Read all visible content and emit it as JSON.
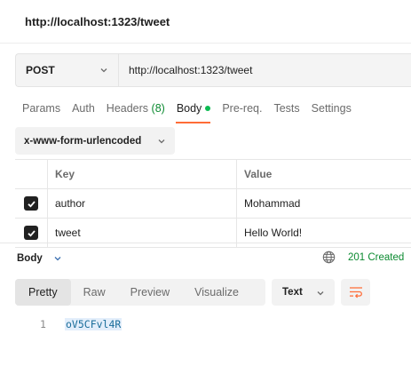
{
  "page": {
    "title": "http://localhost:1323/tweet"
  },
  "request": {
    "method": "POST",
    "url": "http://localhost:1323/tweet",
    "tabs": [
      {
        "label": "Params"
      },
      {
        "label": "Auth"
      },
      {
        "label": "Headers",
        "count": "(8)"
      },
      {
        "label": "Body",
        "active": true,
        "indicator": "green-dot"
      },
      {
        "label": "Pre-req."
      },
      {
        "label": "Tests"
      },
      {
        "label": "Settings"
      }
    ],
    "body_type": "x-www-form-urlencoded",
    "table": {
      "headers": {
        "key": "Key",
        "value": "Value"
      },
      "rows": [
        {
          "checked": true,
          "key": "author",
          "value": "Mohammad"
        },
        {
          "checked": true,
          "key": "tweet",
          "value": "Hello World!"
        }
      ]
    }
  },
  "response": {
    "section_label": "Body",
    "status": "201 Created",
    "status_color": "#0b8a30",
    "view_tabs": [
      "Pretty",
      "Raw",
      "Preview",
      "Visualize"
    ],
    "active_view": "Pretty",
    "format": "Text",
    "wrap_icon": "wrap-lines-icon",
    "lines": [
      {
        "number": "1",
        "text": "oV5CFvl4R"
      }
    ]
  },
  "colors": {
    "accent": "#ff6c37",
    "success": "#0cbb52"
  }
}
